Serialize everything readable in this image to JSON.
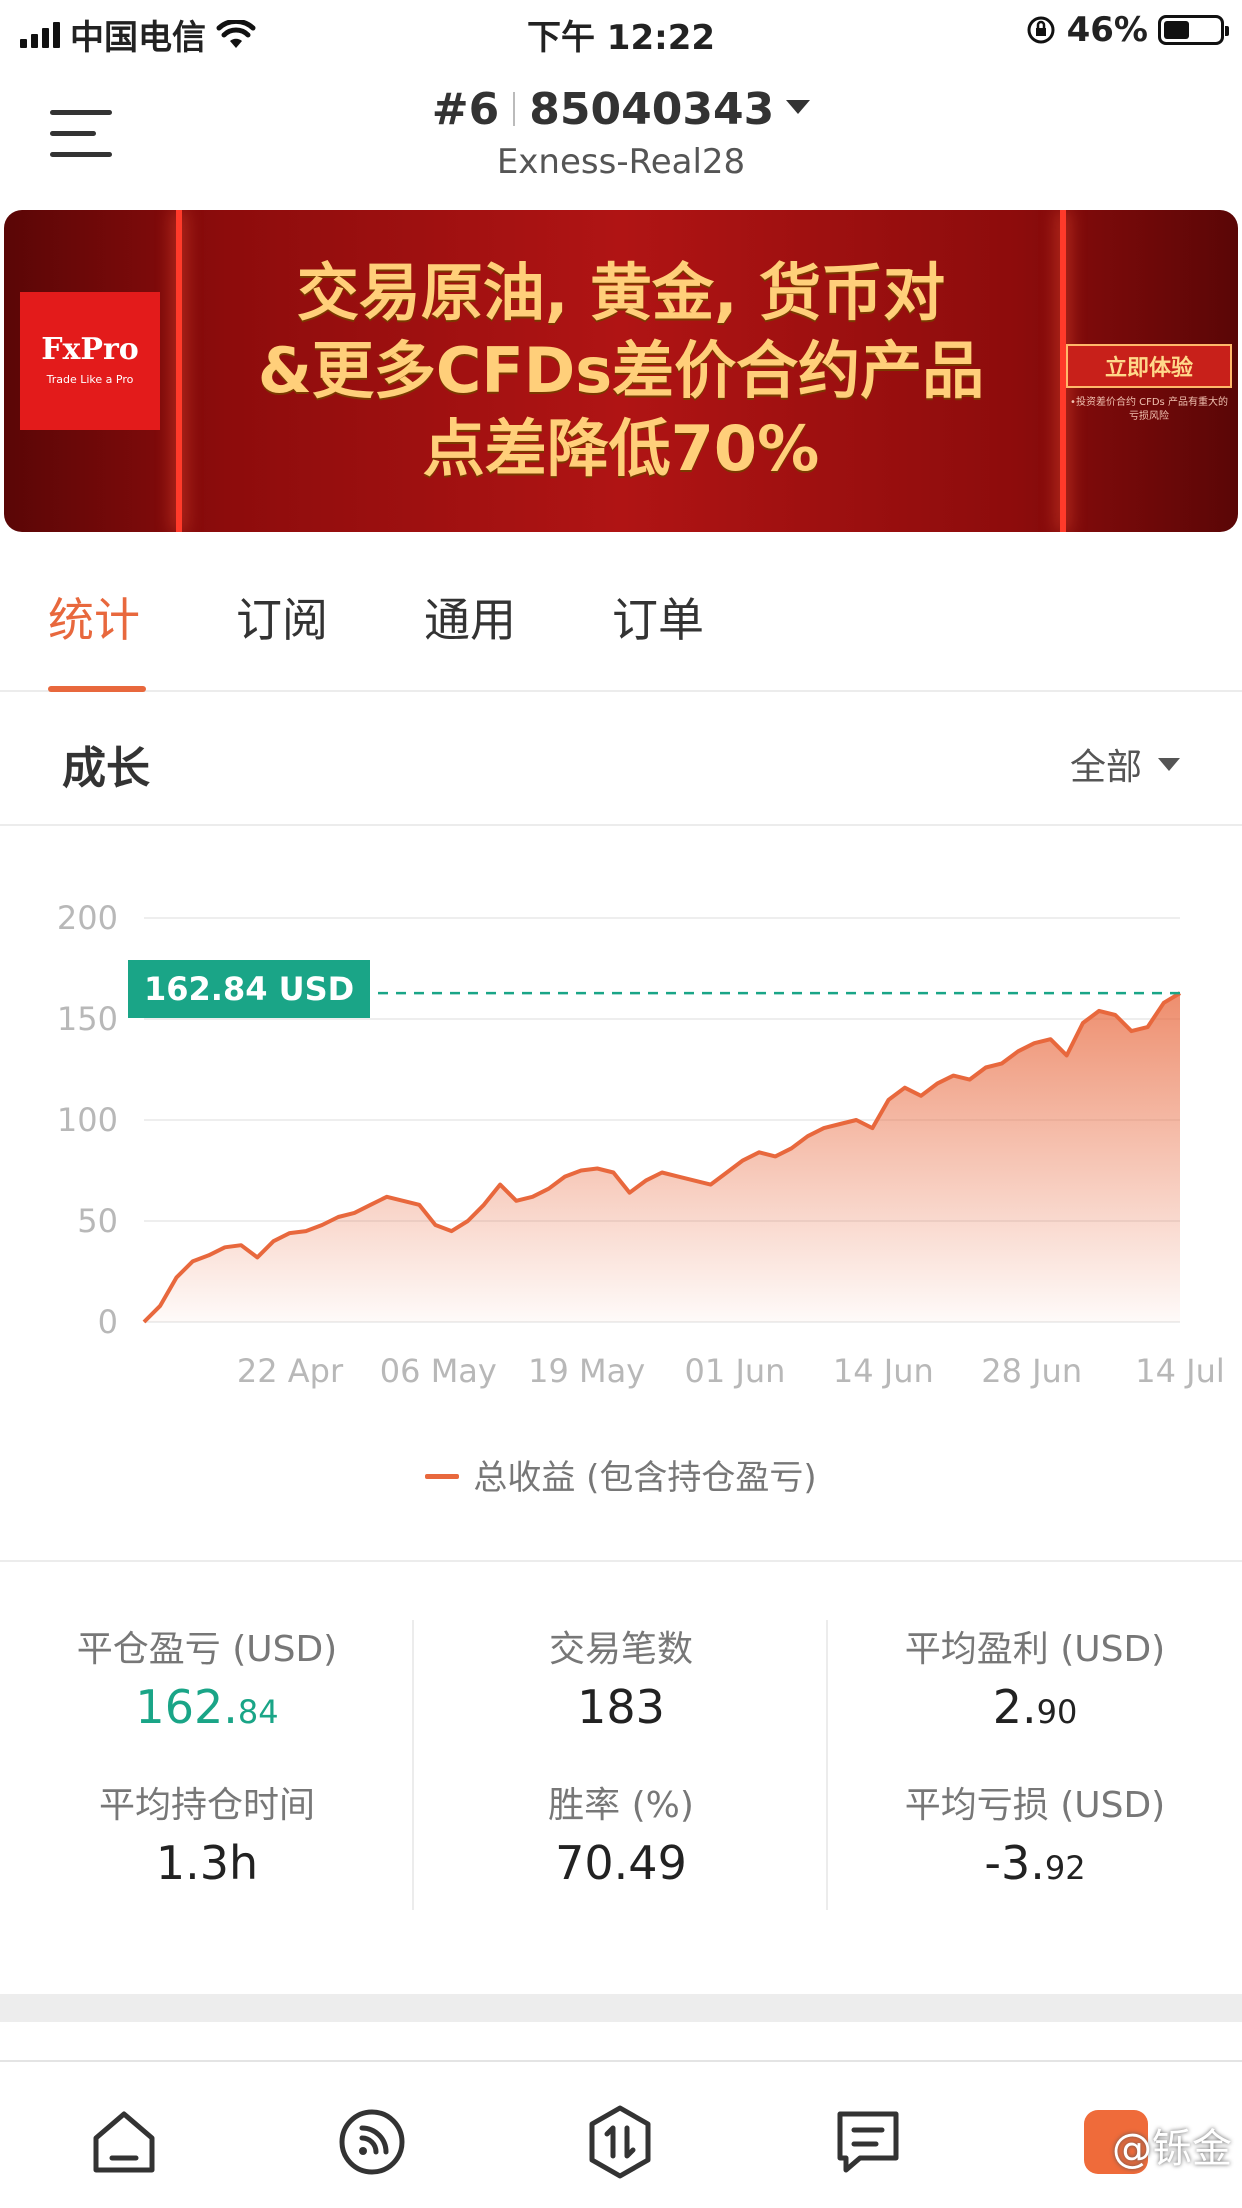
{
  "status_bar": {
    "carrier": "中国电信",
    "time": "下午 12:22",
    "battery": "46%",
    "battery_level": 0.46
  },
  "header": {
    "account_index": "#6",
    "account_number": "85040343",
    "server": "Exness-Real28"
  },
  "banner": {
    "brand": "FxPro",
    "brand_tagline": "Trade Like a Pro",
    "lines": [
      "交易原油, 黄金, 货币对",
      "&更多CFDs差价合约产品",
      "点差降低70%"
    ],
    "cta": "立即体验",
    "disclaimer": "•投资差价合约 CFDs 产品有重大的亏损风险"
  },
  "tabs": [
    {
      "label": "统计",
      "active": true
    },
    {
      "label": "订阅",
      "active": false
    },
    {
      "label": "通用",
      "active": false
    },
    {
      "label": "订单",
      "active": false
    }
  ],
  "growth": {
    "title": "成长",
    "filter": "全部"
  },
  "chart_data": {
    "type": "area",
    "ylim": [
      0,
      200
    ],
    "yticks": [
      "0",
      "50",
      "100",
      "150",
      "200"
    ],
    "xticks": [
      "22 Apr",
      "06 May",
      "19 May",
      "01 Jun",
      "14 Jun",
      "28 Jun",
      "14 Jul"
    ],
    "current_value_label": "162.84 USD",
    "current_value": 162.84,
    "series": [
      {
        "name": "总收益 (包含持仓盈亏)",
        "color": "#e8683d",
        "values": [
          0,
          8,
          22,
          30,
          33,
          37,
          38,
          32,
          40,
          44,
          45,
          48,
          52,
          54,
          58,
          62,
          60,
          58,
          48,
          45,
          50,
          58,
          68,
          60,
          62,
          66,
          72,
          75,
          76,
          74,
          64,
          70,
          74,
          72,
          70,
          68,
          74,
          80,
          84,
          82,
          86,
          92,
          96,
          98,
          100,
          96,
          110,
          116,
          112,
          118,
          122,
          120,
          126,
          128,
          134,
          138,
          140,
          132,
          148,
          154,
          152,
          144,
          146,
          158,
          162.84
        ]
      }
    ]
  },
  "stats": [
    {
      "label": "平仓盈亏 (USD)",
      "int": "162.",
      "dec": "84",
      "green": true
    },
    {
      "label": "交易笔数",
      "int": "183",
      "dec": "",
      "green": false
    },
    {
      "label": "平均盈利 (USD)",
      "int": "2.",
      "dec": "90",
      "green": false
    },
    {
      "label": "平均持仓时间",
      "int": "1.3h",
      "dec": "",
      "green": false
    },
    {
      "label": "胜率 (%)",
      "int": "70.49",
      "dec": "",
      "green": false
    },
    {
      "label": "平均亏损 (USD)",
      "int": "-3.",
      "dec": "92",
      "green": false
    }
  ],
  "bottom_nav": [
    {
      "icon": "home-icon"
    },
    {
      "icon": "signal-icon"
    },
    {
      "icon": "trade-icon"
    },
    {
      "icon": "message-icon"
    },
    {
      "icon": "profile-icon"
    }
  ],
  "watermark": "@铄金",
  "colors": {
    "accent": "#e8683d",
    "positive": "#1aa587"
  }
}
